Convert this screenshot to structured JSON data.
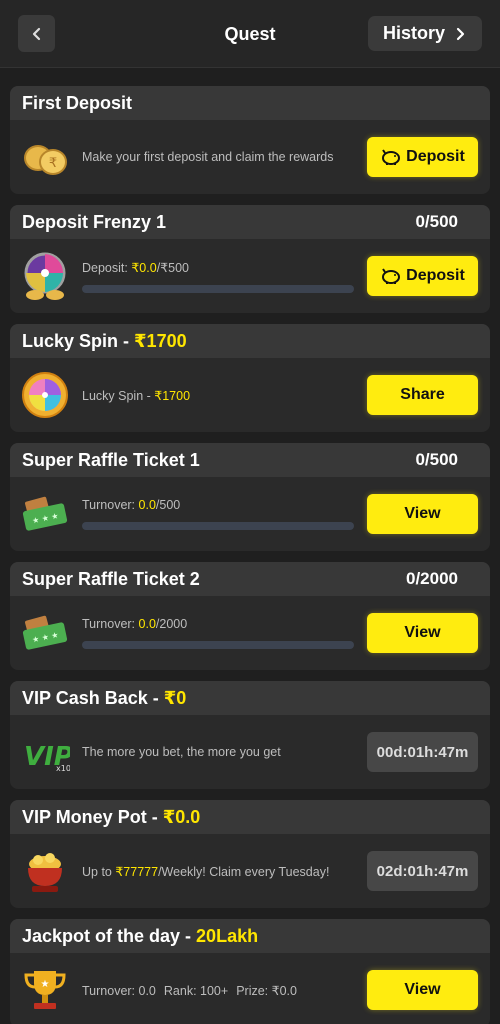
{
  "header": {
    "title": "Quest",
    "history_label": "History"
  },
  "cards": [
    {
      "title": "First Deposit",
      "desc": "Make your first deposit and claim the rewards",
      "button": "Deposit"
    },
    {
      "title": "Deposit Frenzy 1",
      "progress": "0/500",
      "desc_prefix": "Deposit: ",
      "desc_value": "₹0.0",
      "desc_suffix": "/₹500",
      "progress_fraction": 0,
      "button": "Deposit"
    },
    {
      "title": "Lucky Spin - ",
      "title_amount": "₹1700",
      "desc_prefix": "Lucky Spin - ",
      "desc_value": "₹1700",
      "button": "Share"
    },
    {
      "title": "Super Raffle Ticket 1",
      "progress": "0/500",
      "desc_prefix": "Turnover: ",
      "desc_value": "0.0",
      "desc_suffix": "/500",
      "progress_fraction": 0,
      "button": "View"
    },
    {
      "title": "Super Raffle Ticket 2",
      "progress": "0/2000",
      "desc_prefix": "Turnover: ",
      "desc_value": "0.0",
      "desc_suffix": "/2000",
      "progress_fraction": 0,
      "button": "View"
    },
    {
      "title": "VIP Cash Back - ",
      "title_amount": "₹0",
      "desc": "The more you bet, the more you get",
      "timer": "00d:01h:47m"
    },
    {
      "title": "VIP Money Pot - ",
      "title_amount": "₹0.0",
      "desc_prefix": "Up to ",
      "desc_value": "₹77777",
      "desc_suffix": "/Weekly! Claim every Tuesday!",
      "timer": "02d:01h:47m"
    },
    {
      "title": "Jackpot of the day - ",
      "title_amount": "20Lakh",
      "turnover": "Turnover: 0.0",
      "rank": "Rank: 100+",
      "prize": "Prize: ₹0.0",
      "button": "View"
    }
  ],
  "colors": {
    "accent": "#ffec0f",
    "bg": "#1f1f1f",
    "card": "#2a2a2a",
    "card_head": "#383838"
  },
  "icons": [
    "chevron-left-icon",
    "chevron-right-icon",
    "coins-icon",
    "wheel-icon",
    "spin-wheel-icon",
    "ticket-icon",
    "vip-icon",
    "money-pot-icon",
    "trophy-icon",
    "piggy-bank-icon"
  ]
}
